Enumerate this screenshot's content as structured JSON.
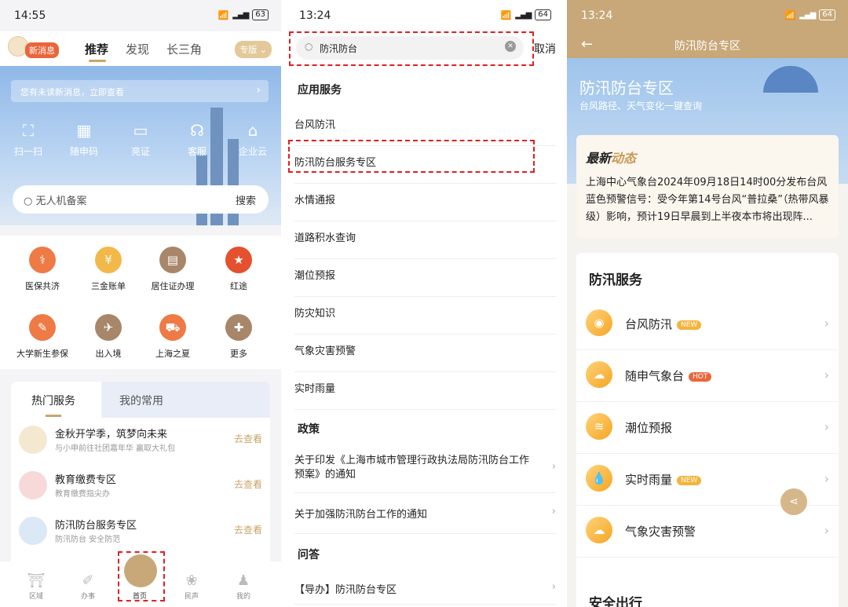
{
  "p1": {
    "status": {
      "time": "14:55",
      "battery": "63"
    },
    "new_msg": "新消息",
    "tabs": [
      "推荐",
      "发现",
      "长三角"
    ],
    "edition": "专版",
    "notice": "您有未读新消息，立即查看",
    "quick": [
      "扫一扫",
      "随申码",
      "亮证",
      "客服",
      "企业云"
    ],
    "search_placeholder": "无人机备案",
    "search_btn": "搜索",
    "grid": [
      "医保共济",
      "三金账单",
      "居住证办理",
      "红途",
      "大学新生参保",
      "出入境",
      "上海之夏",
      "更多"
    ],
    "hot_tabs": [
      "热门服务",
      "我的常用"
    ],
    "hot_items": [
      {
        "title": "金秋开学季，筑梦向未来",
        "sub": "与小申前往社团嘉年华 赢取大礼包",
        "go": "去查看"
      },
      {
        "title": "教育缴费专区",
        "sub": "教育缴费指尖办",
        "go": "去查看"
      },
      {
        "title": "防汛防台服务专区",
        "sub": "防汛防台 安全防范",
        "go": "去查看"
      }
    ],
    "nav": [
      "区域",
      "办事",
      "首页",
      "民声",
      "我的"
    ]
  },
  "p2": {
    "status": {
      "time": "13:24",
      "battery": "64"
    },
    "search_value": "防汛防台",
    "cancel": "取消",
    "sec_app": "应用服务",
    "apps": [
      "台风防汛",
      "防汛防台服务专区",
      "水情通报",
      "道路积水查询",
      "潮位预报",
      "防灾知识",
      "气象灾害预警",
      "实时雨量"
    ],
    "sec_policy": "政策",
    "policies": [
      "关于印发《上海市城市管理行政执法局防汛防台工作预案》的通知",
      "关于加强防汛防台工作的通知"
    ],
    "sec_qa": "问答",
    "qa": [
      "【导办】防汛防台专区"
    ]
  },
  "p3": {
    "status": {
      "time": "13:24",
      "battery": "64"
    },
    "title": "防汛防台专区",
    "banner_title": "防汛防台专区",
    "banner_sub": "台风路径、天气变化一键查询",
    "news_title_a": "最新",
    "news_title_b": "动态",
    "news_body": "上海中心气象台2024年09月18日14时00分发布台风蓝色预警信号：受今年第14号台风“普拉桑”（热带风暴级）影响，预计19日早晨到上半夜本市将出现阵...",
    "services_title": "防汛服务",
    "services": [
      {
        "label": "台风防汛",
        "badge": "NEW"
      },
      {
        "label": "随申气象台",
        "badge": "HOT"
      },
      {
        "label": "潮位预报",
        "badge": ""
      },
      {
        "label": "实时雨量",
        "badge": "NEW"
      },
      {
        "label": "气象灾害预警",
        "badge": ""
      }
    ],
    "safety_title": "安全出行"
  },
  "colors": {
    "accent": "#c9a56a",
    "highlight": "#e02020",
    "hot": "#e9663b",
    "new": "#f5b33a"
  }
}
